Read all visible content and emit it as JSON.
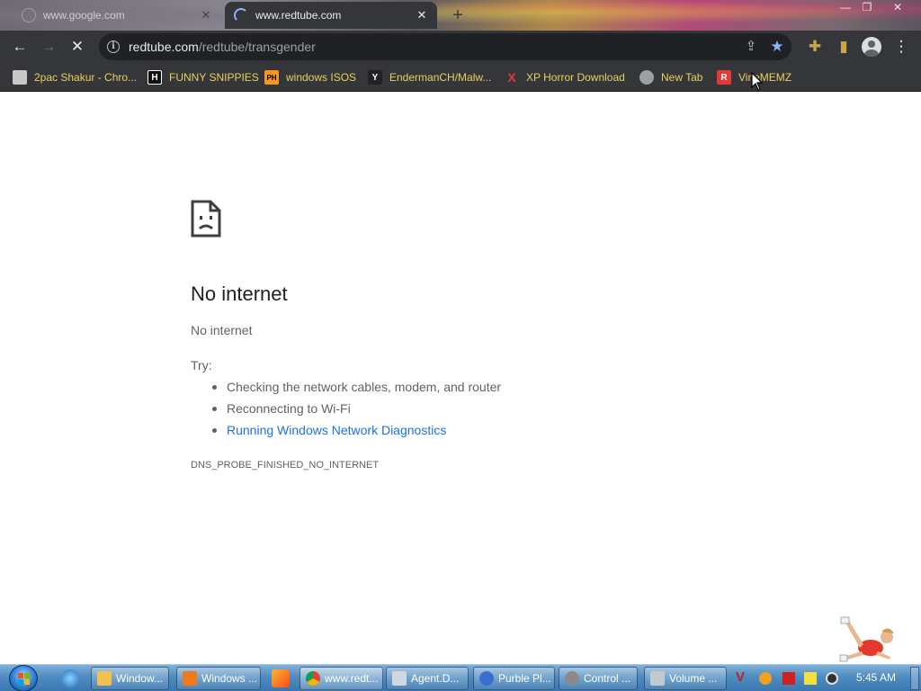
{
  "tabs": {
    "inactive": {
      "title": "www.google.com",
      "close_glyph": "✕"
    },
    "active": {
      "title": "www.redtube.com",
      "close_glyph": "✕"
    },
    "new_tab_glyph": "+"
  },
  "window_controls": {
    "minimize": "—",
    "restore": "❐",
    "close": "✕"
  },
  "toolbar": {
    "back_glyph": "←",
    "forward_glyph": "→",
    "stop_glyph": "✕",
    "url_host": "redtube.com",
    "url_path": "/redtube/transgender",
    "info_glyph": "i",
    "share_glyph": "⇪",
    "star_glyph": "★",
    "extensions_glyph": "✚",
    "sidepanel_glyph": "▮",
    "menu_glyph": "⋮"
  },
  "bookmarks": [
    {
      "label": "2pac Shakur - Chro...",
      "icon_text": "",
      "icon_color": "#c8c8c8"
    },
    {
      "label": "FUNNY SNIPPIES",
      "icon_text": "H",
      "icon_color": "#ffffff"
    },
    {
      "label": "windows ISOS",
      "icon_text": "PH",
      "icon_color": "#f7971d"
    },
    {
      "label": "EndermanCH/Malw...",
      "icon_text": "Y",
      "icon_color": "#222222"
    },
    {
      "label": "XP Horror Download",
      "icon_text": "X",
      "icon_color": "#e53935"
    },
    {
      "label": "New Tab",
      "icon_text": "",
      "icon_color": "#9aa0a6"
    },
    {
      "label": "VineMEMZ",
      "icon_text": "R",
      "icon_color": "#e53935"
    }
  ],
  "error_page": {
    "title": "No internet",
    "subtitle": "No internet",
    "try_label": "Try:",
    "suggestions": [
      "Checking the network cables, modem, and router",
      "Reconnecting to Wi-Fi",
      "Running Windows Network Diagnostics"
    ],
    "error_code": "DNS_PROBE_FINISHED_NO_INTERNET"
  },
  "taskbar": {
    "items": [
      {
        "label": "Window...",
        "icon_color": "#f0c050"
      },
      {
        "label": "Windows ...",
        "icon_color": "#f07a1a"
      },
      {
        "label": "www.redt...",
        "icon_color": "#4caf50"
      },
      {
        "label": "Agent.D...",
        "icon_color": "#d0d8e0"
      },
      {
        "label": "Purble Pl...",
        "icon_color": "#3a6fd0"
      },
      {
        "label": "Control ...",
        "icon_color": "#8a8a8a"
      },
      {
        "label": "Volume ...",
        "icon_color": "#c0c8d0"
      }
    ],
    "clock": "5:45 AM"
  },
  "colors": {
    "link": "#1a73e8",
    "bookmark_text": "#e8d060",
    "star": "#8ab4f8"
  }
}
